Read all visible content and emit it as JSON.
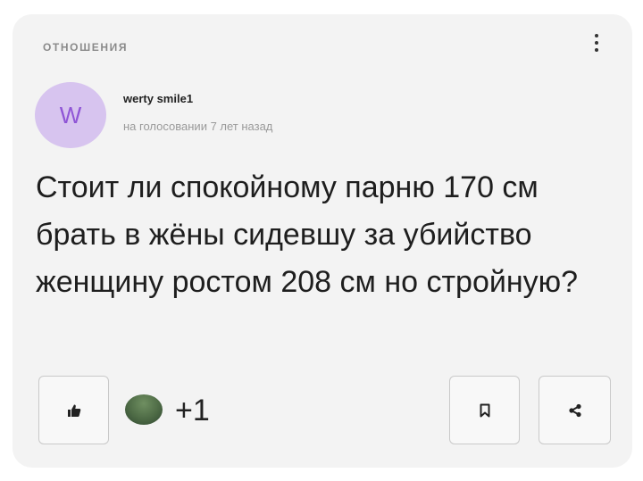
{
  "post": {
    "category": "ОТНОШЕНИЯ",
    "author": {
      "initial": "W",
      "name": "werty smile1",
      "meta": "на голосовании 7 лет назад"
    },
    "question": "Стоит ли спокойному парню 170 см брать в жёны сидевшу за убийство женщину ростом 208 см но стройную?",
    "reactions": {
      "count": "+1"
    }
  },
  "colors": {
    "card_bg": "#f3f3f3",
    "avatar_bg": "#d7c4ef",
    "avatar_letter": "#8f55d6"
  },
  "icons": {
    "menu": "more-vertical-icon",
    "like": "thumbs-up-icon",
    "reaction": "reaction-image-icon",
    "bookmark": "bookmark-icon",
    "share": "share-icon"
  }
}
